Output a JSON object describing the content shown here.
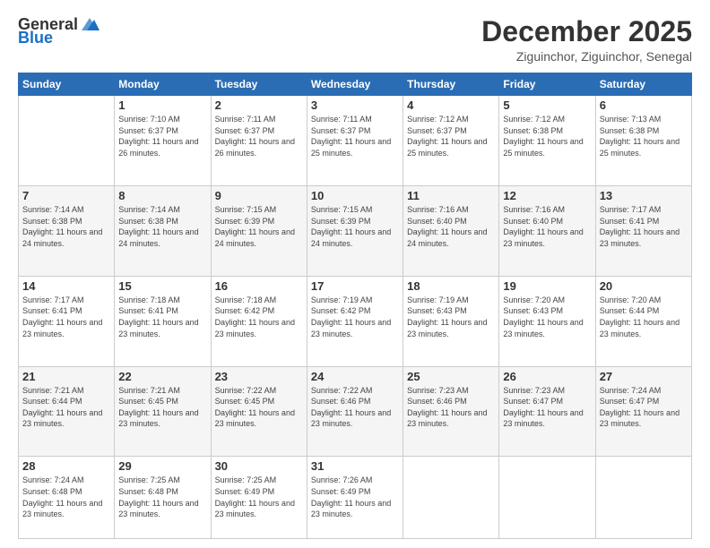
{
  "header": {
    "logo_general": "General",
    "logo_blue": "Blue",
    "month": "December 2025",
    "location": "Ziguinchor, Ziguinchor, Senegal"
  },
  "days_of_week": [
    "Sunday",
    "Monday",
    "Tuesday",
    "Wednesday",
    "Thursday",
    "Friday",
    "Saturday"
  ],
  "weeks": [
    [
      {
        "day": "",
        "sunrise": "",
        "sunset": "",
        "daylight": ""
      },
      {
        "day": "1",
        "sunrise": "Sunrise: 7:10 AM",
        "sunset": "Sunset: 6:37 PM",
        "daylight": "Daylight: 11 hours and 26 minutes."
      },
      {
        "day": "2",
        "sunrise": "Sunrise: 7:11 AM",
        "sunset": "Sunset: 6:37 PM",
        "daylight": "Daylight: 11 hours and 26 minutes."
      },
      {
        "day": "3",
        "sunrise": "Sunrise: 7:11 AM",
        "sunset": "Sunset: 6:37 PM",
        "daylight": "Daylight: 11 hours and 25 minutes."
      },
      {
        "day": "4",
        "sunrise": "Sunrise: 7:12 AM",
        "sunset": "Sunset: 6:37 PM",
        "daylight": "Daylight: 11 hours and 25 minutes."
      },
      {
        "day": "5",
        "sunrise": "Sunrise: 7:12 AM",
        "sunset": "Sunset: 6:38 PM",
        "daylight": "Daylight: 11 hours and 25 minutes."
      },
      {
        "day": "6",
        "sunrise": "Sunrise: 7:13 AM",
        "sunset": "Sunset: 6:38 PM",
        "daylight": "Daylight: 11 hours and 25 minutes."
      }
    ],
    [
      {
        "day": "7",
        "sunrise": "Sunrise: 7:14 AM",
        "sunset": "Sunset: 6:38 PM",
        "daylight": "Daylight: 11 hours and 24 minutes."
      },
      {
        "day": "8",
        "sunrise": "Sunrise: 7:14 AM",
        "sunset": "Sunset: 6:38 PM",
        "daylight": "Daylight: 11 hours and 24 minutes."
      },
      {
        "day": "9",
        "sunrise": "Sunrise: 7:15 AM",
        "sunset": "Sunset: 6:39 PM",
        "daylight": "Daylight: 11 hours and 24 minutes."
      },
      {
        "day": "10",
        "sunrise": "Sunrise: 7:15 AM",
        "sunset": "Sunset: 6:39 PM",
        "daylight": "Daylight: 11 hours and 24 minutes."
      },
      {
        "day": "11",
        "sunrise": "Sunrise: 7:16 AM",
        "sunset": "Sunset: 6:40 PM",
        "daylight": "Daylight: 11 hours and 24 minutes."
      },
      {
        "day": "12",
        "sunrise": "Sunrise: 7:16 AM",
        "sunset": "Sunset: 6:40 PM",
        "daylight": "Daylight: 11 hours and 23 minutes."
      },
      {
        "day": "13",
        "sunrise": "Sunrise: 7:17 AM",
        "sunset": "Sunset: 6:41 PM",
        "daylight": "Daylight: 11 hours and 23 minutes."
      }
    ],
    [
      {
        "day": "14",
        "sunrise": "Sunrise: 7:17 AM",
        "sunset": "Sunset: 6:41 PM",
        "daylight": "Daylight: 11 hours and 23 minutes."
      },
      {
        "day": "15",
        "sunrise": "Sunrise: 7:18 AM",
        "sunset": "Sunset: 6:41 PM",
        "daylight": "Daylight: 11 hours and 23 minutes."
      },
      {
        "day": "16",
        "sunrise": "Sunrise: 7:18 AM",
        "sunset": "Sunset: 6:42 PM",
        "daylight": "Daylight: 11 hours and 23 minutes."
      },
      {
        "day": "17",
        "sunrise": "Sunrise: 7:19 AM",
        "sunset": "Sunset: 6:42 PM",
        "daylight": "Daylight: 11 hours and 23 minutes."
      },
      {
        "day": "18",
        "sunrise": "Sunrise: 7:19 AM",
        "sunset": "Sunset: 6:43 PM",
        "daylight": "Daylight: 11 hours and 23 minutes."
      },
      {
        "day": "19",
        "sunrise": "Sunrise: 7:20 AM",
        "sunset": "Sunset: 6:43 PM",
        "daylight": "Daylight: 11 hours and 23 minutes."
      },
      {
        "day": "20",
        "sunrise": "Sunrise: 7:20 AM",
        "sunset": "Sunset: 6:44 PM",
        "daylight": "Daylight: 11 hours and 23 minutes."
      }
    ],
    [
      {
        "day": "21",
        "sunrise": "Sunrise: 7:21 AM",
        "sunset": "Sunset: 6:44 PM",
        "daylight": "Daylight: 11 hours and 23 minutes."
      },
      {
        "day": "22",
        "sunrise": "Sunrise: 7:21 AM",
        "sunset": "Sunset: 6:45 PM",
        "daylight": "Daylight: 11 hours and 23 minutes."
      },
      {
        "day": "23",
        "sunrise": "Sunrise: 7:22 AM",
        "sunset": "Sunset: 6:45 PM",
        "daylight": "Daylight: 11 hours and 23 minutes."
      },
      {
        "day": "24",
        "sunrise": "Sunrise: 7:22 AM",
        "sunset": "Sunset: 6:46 PM",
        "daylight": "Daylight: 11 hours and 23 minutes."
      },
      {
        "day": "25",
        "sunrise": "Sunrise: 7:23 AM",
        "sunset": "Sunset: 6:46 PM",
        "daylight": "Daylight: 11 hours and 23 minutes."
      },
      {
        "day": "26",
        "sunrise": "Sunrise: 7:23 AM",
        "sunset": "Sunset: 6:47 PM",
        "daylight": "Daylight: 11 hours and 23 minutes."
      },
      {
        "day": "27",
        "sunrise": "Sunrise: 7:24 AM",
        "sunset": "Sunset: 6:47 PM",
        "daylight": "Daylight: 11 hours and 23 minutes."
      }
    ],
    [
      {
        "day": "28",
        "sunrise": "Sunrise: 7:24 AM",
        "sunset": "Sunset: 6:48 PM",
        "daylight": "Daylight: 11 hours and 23 minutes."
      },
      {
        "day": "29",
        "sunrise": "Sunrise: 7:25 AM",
        "sunset": "Sunset: 6:48 PM",
        "daylight": "Daylight: 11 hours and 23 minutes."
      },
      {
        "day": "30",
        "sunrise": "Sunrise: 7:25 AM",
        "sunset": "Sunset: 6:49 PM",
        "daylight": "Daylight: 11 hours and 23 minutes."
      },
      {
        "day": "31",
        "sunrise": "Sunrise: 7:26 AM",
        "sunset": "Sunset: 6:49 PM",
        "daylight": "Daylight: 11 hours and 23 minutes."
      },
      {
        "day": "",
        "sunrise": "",
        "sunset": "",
        "daylight": ""
      },
      {
        "day": "",
        "sunrise": "",
        "sunset": "",
        "daylight": ""
      },
      {
        "day": "",
        "sunrise": "",
        "sunset": "",
        "daylight": ""
      }
    ]
  ]
}
